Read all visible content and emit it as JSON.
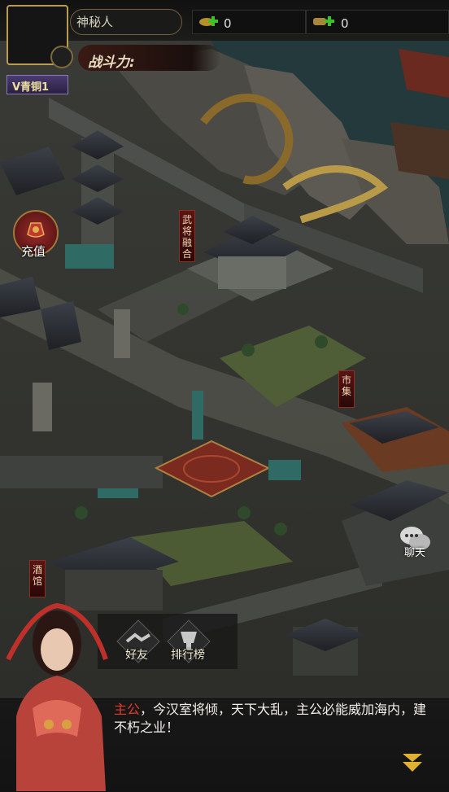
{
  "player": {
    "name": "神秘人",
    "power_label": "战斗力:",
    "vip_label": "V青铜1"
  },
  "resources": [
    {
      "icon": "gold-ingot-plus-icon",
      "value": "0"
    },
    {
      "icon": "scroll-plus-icon",
      "value": "0"
    }
  ],
  "side_buttons": {
    "recharge": "充值"
  },
  "map_banners": {
    "general_fusion": "武将融合",
    "market": "市集",
    "tavern": "酒馆"
  },
  "chat": {
    "label": "聊天"
  },
  "bottom_menu": [
    {
      "label": "好友",
      "icon": "handshake-icon"
    },
    {
      "label": "排行榜",
      "icon": "trophy-icon"
    }
  ],
  "dialog": {
    "speaker": "主公",
    "text": "，今汉室将倾，天下大乱，主公必能威加海内，建不朽之业！"
  },
  "colors": {
    "accent_gold": "#b79c52",
    "speaker_red": "#e33b2a",
    "plus_green": "#3fbf2a"
  }
}
